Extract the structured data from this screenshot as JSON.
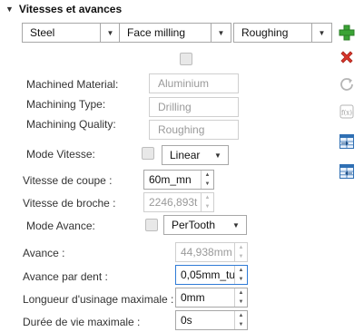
{
  "section": {
    "title": "Vitesses et avances"
  },
  "combos": {
    "material": "Steel",
    "type": "Face milling",
    "quality": "Roughing"
  },
  "machined": {
    "material_label": "Machined Material:",
    "material_value": "Aluminium",
    "type_label": "Machining Type:",
    "type_value": "Drilling",
    "quality_label": "Machining Quality:",
    "quality_value": "Roughing"
  },
  "mode_vitesse": {
    "label": "Mode Vitesse:",
    "value": "Linear"
  },
  "vitesse_coupe": {
    "label": "Vitesse de coupe :",
    "value": "60m_mn"
  },
  "vitesse_broche": {
    "label": "Vitesse de broche :",
    "value": "2246,893t"
  },
  "mode_avance": {
    "label": "Mode Avance:",
    "value": "PerTooth"
  },
  "avance": {
    "label": "Avance :",
    "value": "44,938mm"
  },
  "avance_dent": {
    "label": "Avance par dent :",
    "value": "0,05mm_tu"
  },
  "longueur": {
    "label": "Longueur d'usinage maximale :",
    "value": "0mm"
  },
  "duree": {
    "label": "Durée de vie maximale :",
    "value": "0s"
  },
  "toolbar": {
    "icons": [
      "add-icon",
      "delete-icon",
      "refresh-icon",
      "formula-icon",
      "import-table-icon",
      "export-table-icon"
    ],
    "accent_green": "#3aa335",
    "accent_red": "#d9362b",
    "accent_blue": "#2f6fb3"
  }
}
